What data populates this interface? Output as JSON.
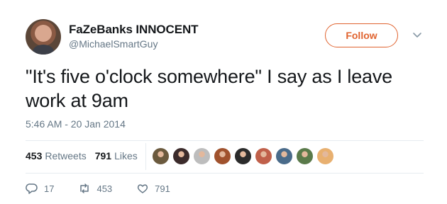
{
  "user": {
    "display_name": "FaZeBanks INNOCENT",
    "handle": "@MichaelSmartGuy"
  },
  "follow_button": {
    "label": "Follow",
    "color": "#e0632f"
  },
  "tweet": {
    "text": "\"It's five o'clock somewhere\" I say as I leave work at 9am",
    "timestamp": "5:46 AM - 20 Jan 2014"
  },
  "stats": {
    "retweets_count": "453",
    "retweets_label": "Retweets",
    "likes_count": "791",
    "likes_label": "Likes"
  },
  "likers": [
    "#6b5a3e",
    "#3b2b2b",
    "#bdbdbd",
    "#a0522d",
    "#2b2b2b",
    "#c0604a",
    "#4a6b8a",
    "#5a7a4a",
    "#e8b070"
  ],
  "actions": {
    "reply_count": "17",
    "retweet_count": "453",
    "like_count": "791"
  }
}
